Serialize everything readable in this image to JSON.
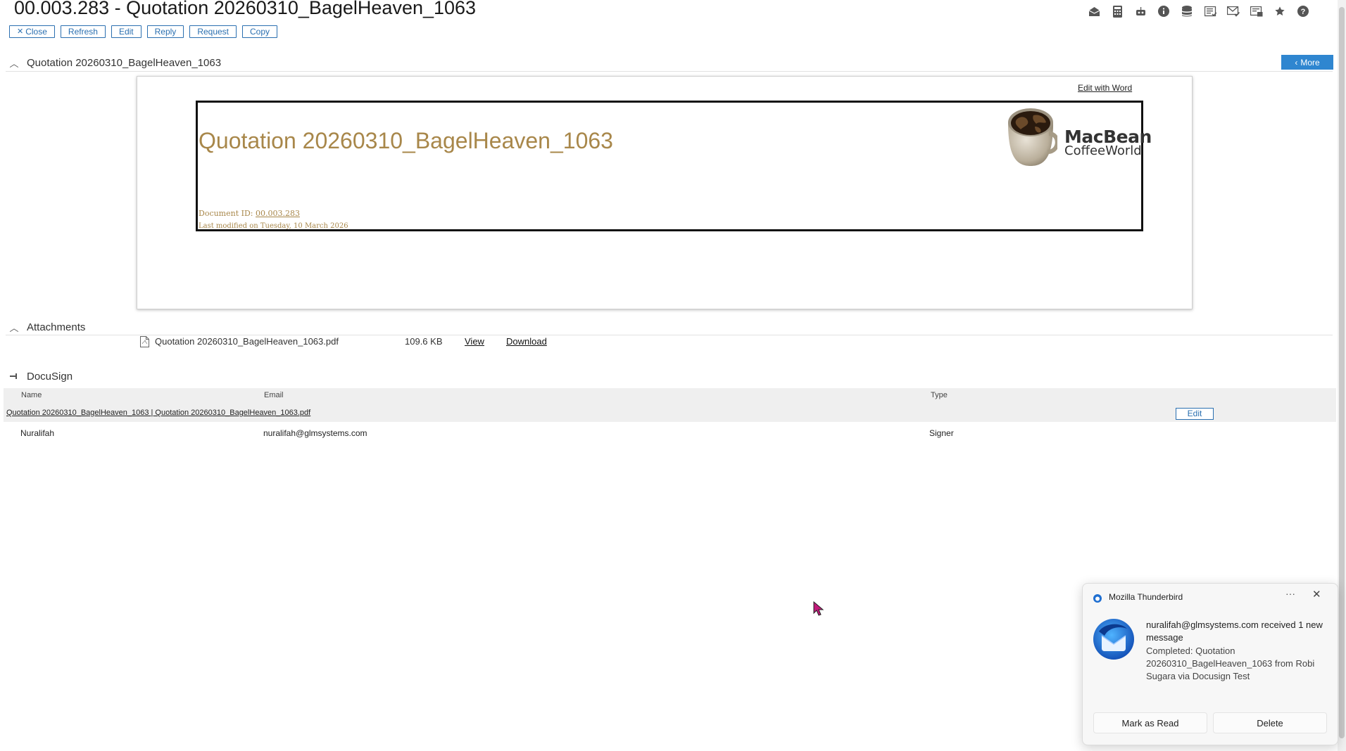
{
  "header": {
    "title": "00.003.283 - Quotation 20260310_BagelHeaven_1063",
    "buttons": {
      "close": "Close",
      "refresh": "Refresh",
      "edit": "Edit",
      "reply": "Reply",
      "request": "Request",
      "copy": "Copy"
    },
    "toolbar_icons": [
      "envelope-open-icon",
      "calculator-icon",
      "robot-icon",
      "info-icon",
      "database-icon",
      "list-check-icon",
      "mail-check-icon",
      "mail-stack-icon",
      "star-icon",
      "help-icon"
    ]
  },
  "document_section": {
    "heading": "Quotation 20260310_BagelHeaven_1063",
    "more_label": "More",
    "edit_with_word": "Edit with Word",
    "doc_title": "Quotation 20260310_BagelHeaven_1063",
    "doc_id_label": "Document ID:",
    "doc_id_value": "00.003.283",
    "last_modified": "Last modified on Tuesday, 10 March 2026",
    "logo": {
      "line1": "MacBean",
      "line2": "CoffeeWorld"
    }
  },
  "attachments": {
    "heading": "Attachments",
    "items": [
      {
        "filename": "Quotation 20260310_BagelHeaven_1063.pdf",
        "size": "109.6 KB",
        "view_label": "View",
        "download_label": "Download"
      }
    ]
  },
  "docusign": {
    "heading": "DocuSign",
    "columns": {
      "name": "Name",
      "email": "Email",
      "type": "Type"
    },
    "envelope_title": "Quotation 20260310_BagelHeaven_1063 | Quotation 20260310_BagelHeaven_1063.pdf",
    "edit_label": "Edit",
    "rows": [
      {
        "name": "Nuralifah",
        "email": "nuralifah@glmsystems.com",
        "type": "Signer"
      }
    ]
  },
  "notification": {
    "app_name": "Mozilla Thunderbird",
    "line1": "nuralifah@glmsystems.com received 1 new message",
    "line2": "Completed: Quotation 20260310_BagelHeaven_1063 from Robi Sugara via Docusign Test",
    "mark_read_label": "Mark as Read",
    "delete_label": "Delete",
    "dots": "···",
    "close_glyph": "✕"
  },
  "colors": {
    "accent": "#2f86d0",
    "doc_gold": "#a8874a"
  }
}
